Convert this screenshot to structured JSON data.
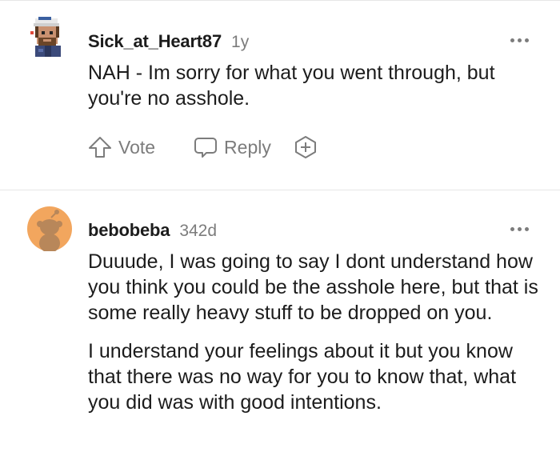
{
  "comments": [
    {
      "username": "Sick_at_Heart87",
      "age": "1y",
      "paragraphs": [
        "NAH - Im sorry for what you went through, but you're no asshole."
      ],
      "actions": {
        "vote_label": "Vote",
        "reply_label": "Reply"
      }
    },
    {
      "username": "bebobeba",
      "age": "342d",
      "paragraphs": [
        "Duuude, I was going to say I dont understand how you think you could be the asshole here, but that is some really heavy stuff to be dropped on you.",
        "I understand your feelings about it but you know that there was no way for you to know that, what you did was with good intentions."
      ]
    }
  ],
  "colors": {
    "text": "#1c1c1c",
    "meta_gray": "#7c7c7c",
    "divider": "#e6e6e6",
    "snoo_orange": "#f2a65e"
  },
  "icons": [
    "avatar-pixel-character",
    "more-options-icon",
    "upvote-arrow-icon",
    "reply-bubble-icon",
    "award-plus-icon",
    "snoo-avatar"
  ]
}
